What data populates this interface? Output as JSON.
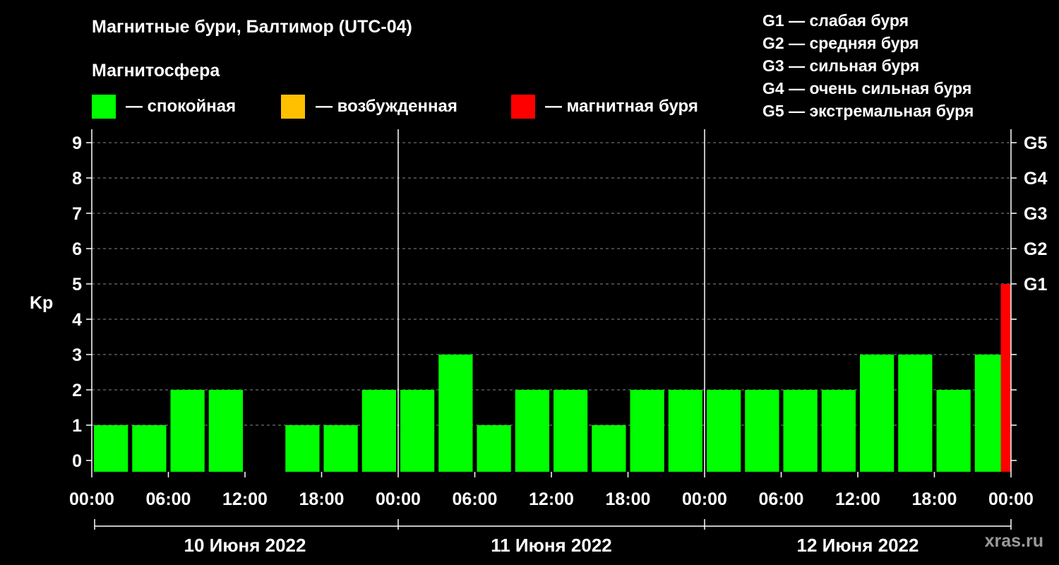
{
  "title": "Магнитные бури, Балтимор (UTC-04)",
  "subtitle": "Магнитосфера",
  "legend": [
    {
      "label": "— спокойная",
      "color": "#00ff00"
    },
    {
      "label": "— возбужденная",
      "color": "#ffc000"
    },
    {
      "label": "— магнитная буря",
      "color": "#ff0000"
    }
  ],
  "g_legend": [
    "G1 — слабая буря",
    "G2 — средняя буря",
    "G3 — сильная буря",
    "G4 — очень сильная буря",
    "G5 — экстремальная буря"
  ],
  "site": "xras.ru",
  "chart_data": {
    "type": "bar",
    "ylabel": "Kp",
    "ylim": [
      0,
      9
    ],
    "y_ticks": [
      "0",
      "1",
      "2",
      "3",
      "4",
      "5",
      "6",
      "7",
      "8",
      "9"
    ],
    "g_ticks": [
      {
        "kp": 5,
        "label": "G1"
      },
      {
        "kp": 6,
        "label": "G2"
      },
      {
        "kp": 7,
        "label": "G3"
      },
      {
        "kp": 8,
        "label": "G4"
      },
      {
        "kp": 9,
        "label": "G5"
      }
    ],
    "x_tick_labels": [
      "00:00",
      "06:00",
      "12:00",
      "18:00",
      "00:00",
      "06:00",
      "12:00",
      "18:00",
      "00:00",
      "06:00",
      "12:00",
      "18:00",
      "00:00"
    ],
    "days": [
      "10 Июня 2022",
      "11 Июня 2022",
      "12 Июня 2022"
    ],
    "hours_total": 72,
    "bars": [
      {
        "start": 0,
        "end": 3,
        "kp": 1
      },
      {
        "start": 3,
        "end": 6,
        "kp": 1
      },
      {
        "start": 6,
        "end": 9,
        "kp": 2
      },
      {
        "start": 9,
        "end": 12,
        "kp": 2
      },
      {
        "start": 12,
        "end": 15,
        "kp": 0
      },
      {
        "start": 15,
        "end": 18,
        "kp": 1
      },
      {
        "start": 18,
        "end": 21,
        "kp": 1
      },
      {
        "start": 21,
        "end": 24,
        "kp": 2
      },
      {
        "start": 24,
        "end": 27,
        "kp": 2
      },
      {
        "start": 27,
        "end": 30,
        "kp": 3
      },
      {
        "start": 30,
        "end": 33,
        "kp": 1
      },
      {
        "start": 33,
        "end": 36,
        "kp": 2
      },
      {
        "start": 36,
        "end": 39,
        "kp": 2
      },
      {
        "start": 39,
        "end": 42,
        "kp": 1
      },
      {
        "start": 42,
        "end": 45,
        "kp": 2
      },
      {
        "start": 45,
        "end": 48,
        "kp": 2
      },
      {
        "start": 48,
        "end": 51,
        "kp": 2
      },
      {
        "start": 51,
        "end": 54,
        "kp": 2
      },
      {
        "start": 54,
        "end": 57,
        "kp": 2
      },
      {
        "start": 57,
        "end": 60,
        "kp": 2
      },
      {
        "start": 60,
        "end": 63,
        "kp": 3
      },
      {
        "start": 63,
        "end": 66,
        "kp": 3
      },
      {
        "start": 66,
        "end": 69,
        "kp": 2
      },
      {
        "start": 69,
        "end": 72,
        "kp": 3
      },
      {
        "start": 71.2,
        "end": 72,
        "kp": 5
      }
    ]
  }
}
